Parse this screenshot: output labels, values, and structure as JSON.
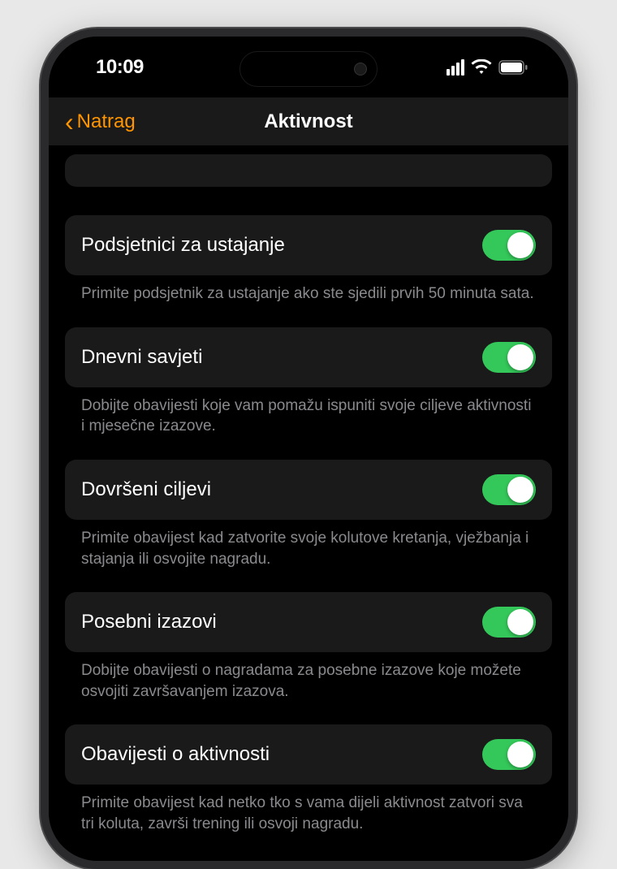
{
  "status": {
    "time": "10:09"
  },
  "nav": {
    "back_label": "Natrag",
    "title": "Aktivnost"
  },
  "settings": [
    {
      "id": "stand-reminders",
      "label": "Podsjetnici za ustajanje",
      "desc": "Primite podsjetnik za ustajanje ako ste sjedili prvih 50 minuta sata.",
      "on": true
    },
    {
      "id": "daily-coaching",
      "label": "Dnevni savjeti",
      "desc": "Dobijte obavijesti koje vam pomažu ispuniti svoje ciljeve aktivnosti i mjesečne izazove.",
      "on": true
    },
    {
      "id": "goal-completions",
      "label": "Dovršeni ciljevi",
      "desc": "Primite obavijest kad zatvorite svoje kolutove kretanja, vježbanja i stajanja ili osvojite nagradu.",
      "on": true
    },
    {
      "id": "special-challenges",
      "label": "Posebni izazovi",
      "desc": "Dobijte obavijesti o nagradama za posebne izazove koje možete osvojiti završavanjem izazova.",
      "on": true
    },
    {
      "id": "activity-sharing",
      "label": "Obavijesti o aktivnosti",
      "desc": "Primite obavijest kad netko tko s vama dijeli aktivnost zatvori sva tri koluta, završi trening ili osvoji nagradu.",
      "on": true
    }
  ]
}
